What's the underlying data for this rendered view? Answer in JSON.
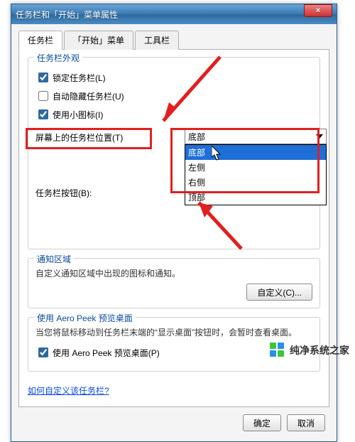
{
  "window": {
    "title": "任务栏和「开始」菜单属性",
    "close": "×"
  },
  "tabs": {
    "0": "任务栏",
    "1": "「开始」菜单",
    "2": "工具栏"
  },
  "appearance": {
    "title": "任务栏外观",
    "lock": "锁定任务栏(L)",
    "autohide": "自动隐藏任务栏(U)",
    "smallicons": "使用小图标(I)",
    "position_label": "屏幕上的任务栏位置(T)",
    "position_value": "底部",
    "position_options": {
      "0": "底部",
      "1": "左侧",
      "2": "右侧",
      "3": "顶部"
    },
    "buttons_label": "任务栏按钮(B):"
  },
  "notify": {
    "title": "通知区域",
    "desc": "自定义通知区域中出现的图标和通知。",
    "customize": "自定义(C)..."
  },
  "aero": {
    "title": "使用 Aero Peek 预览桌面",
    "desc": "当您将鼠标移动到任务栏末端的“显示桌面”按钮时，会暂时查看桌面。",
    "chk": "使用 Aero Peek 预览桌面(P)"
  },
  "link": "如何自定义该任务栏?",
  "buttons": {
    "ok": "确定",
    "cancel": "取消"
  },
  "watermark": "纯净系统之家"
}
